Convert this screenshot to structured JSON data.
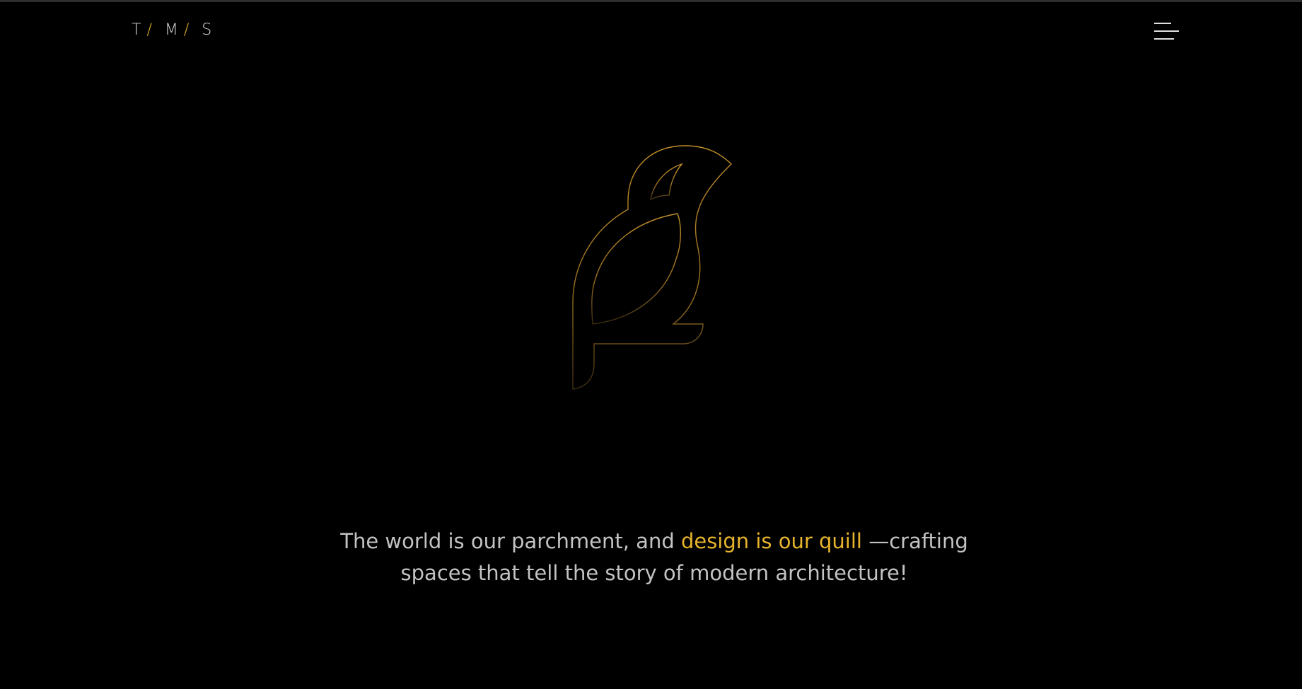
{
  "header": {
    "logo": {
      "letters": [
        "T",
        "M",
        "S"
      ],
      "separator": "/"
    },
    "menu_icon": "hamburger-menu-icon"
  },
  "hero": {
    "emblem_icon": "bird-outline-icon",
    "tagline": {
      "part1": "The world is our parchment, and ",
      "highlight": "design is our quill",
      "part2": " —crafting",
      "line2": "spaces that tell the story of modern architecture!"
    }
  },
  "colors": {
    "background": "#000000",
    "accent": "#e7b42c",
    "text": "#c3c3c3"
  }
}
